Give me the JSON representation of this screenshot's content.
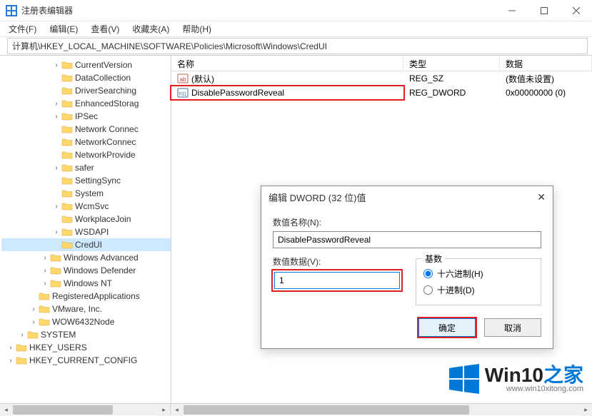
{
  "window": {
    "title": "注册表编辑器"
  },
  "menu": {
    "file": "文件(F)",
    "edit": "编辑(E)",
    "view": "查看(V)",
    "favorites": "收藏夹(A)",
    "help": "帮助(H)"
  },
  "address": {
    "path": "计算机\\HKEY_LOCAL_MACHINE\\SOFTWARE\\Policies\\Microsoft\\Windows\\CredUI"
  },
  "tree": {
    "items": [
      {
        "label": "CurrentVersion",
        "indent": 4,
        "exp": "›"
      },
      {
        "label": "DataCollection",
        "indent": 4,
        "exp": ""
      },
      {
        "label": "DriverSearching",
        "indent": 4,
        "exp": ""
      },
      {
        "label": "EnhancedStorag",
        "indent": 4,
        "exp": "›"
      },
      {
        "label": "IPSec",
        "indent": 4,
        "exp": "›"
      },
      {
        "label": "Network Connec",
        "indent": 4,
        "exp": ""
      },
      {
        "label": "NetworkConnec",
        "indent": 4,
        "exp": ""
      },
      {
        "label": "NetworkProvide",
        "indent": 4,
        "exp": ""
      },
      {
        "label": "safer",
        "indent": 4,
        "exp": "›"
      },
      {
        "label": "SettingSync",
        "indent": 4,
        "exp": ""
      },
      {
        "label": "System",
        "indent": 4,
        "exp": ""
      },
      {
        "label": "WcmSvc",
        "indent": 4,
        "exp": "›"
      },
      {
        "label": "WorkplaceJoin",
        "indent": 4,
        "exp": ""
      },
      {
        "label": "WSDAPI",
        "indent": 4,
        "exp": "›"
      },
      {
        "label": "CredUI",
        "indent": 4,
        "exp": "",
        "selected": true
      },
      {
        "label": "Windows Advanced",
        "indent": 3,
        "exp": "›"
      },
      {
        "label": "Windows Defender",
        "indent": 3,
        "exp": "›"
      },
      {
        "label": "Windows NT",
        "indent": 3,
        "exp": "›"
      },
      {
        "label": "RegisteredApplications",
        "indent": 2,
        "exp": ""
      },
      {
        "label": "VMware, Inc.",
        "indent": 2,
        "exp": "›"
      },
      {
        "label": "WOW6432Node",
        "indent": 2,
        "exp": "›"
      },
      {
        "label": "SYSTEM",
        "indent": 1,
        "exp": "›"
      },
      {
        "label": "HKEY_USERS",
        "indent": 0,
        "exp": "›"
      },
      {
        "label": "HKEY_CURRENT_CONFIG",
        "indent": 0,
        "exp": "›"
      }
    ]
  },
  "list": {
    "headers": {
      "name": "名称",
      "type": "类型",
      "data": "数据"
    },
    "rows": [
      {
        "icon": "str",
        "name": "(默认)",
        "type": "REG_SZ",
        "data": "(数值未设置)"
      },
      {
        "icon": "bin",
        "name": "DisablePasswordReveal",
        "type": "REG_DWORD",
        "data": "0x00000000 (0)",
        "highlight": true
      }
    ]
  },
  "dialog": {
    "title": "编辑 DWORD (32 位)值",
    "labels": {
      "name": "数值名称(N):",
      "data": "数值数据(V):",
      "base": "基数"
    },
    "name_value": "DisablePasswordReveal",
    "data_value": "1",
    "radio": {
      "hex": "十六进制(H)",
      "dec": "十进制(D)"
    },
    "buttons": {
      "ok": "确定",
      "cancel": "取消"
    }
  },
  "watermark": {
    "brand_pre": "Win10",
    "brand_suf": "之家",
    "url": "www.win10xitong.com"
  }
}
